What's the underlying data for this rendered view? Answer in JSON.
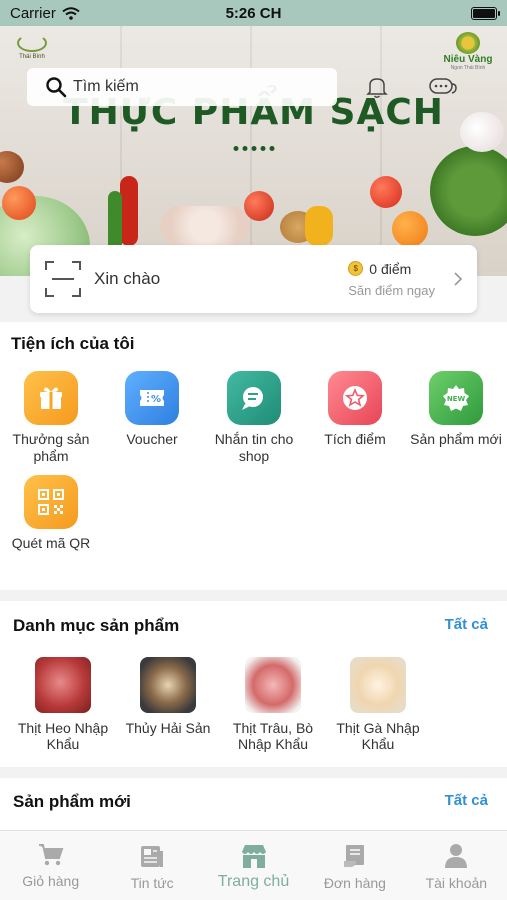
{
  "status_bar": {
    "carrier": "Carrier",
    "time": "5:26 CH"
  },
  "banner": {
    "title": "THỰC PHẨM SẠCH",
    "brand_left": "Thái Bình",
    "brand_right": "Niêu Vàng",
    "brand_right_sub": "Ngon Thái Bình"
  },
  "search": {
    "placeholder": "Tìm kiếm"
  },
  "greeting": {
    "text": "Xin chào",
    "points": "0 điểm",
    "points_action": "Săn điểm ngay"
  },
  "utilities": {
    "title": "Tiện ích của tôi",
    "items": [
      {
        "label": "Thưởng sản phẩm",
        "icon": "gift-icon",
        "color": "#f5a623"
      },
      {
        "label": "Voucher",
        "icon": "voucher-icon",
        "color": "#3a8ee6"
      },
      {
        "label": "Nhắn tin cho shop",
        "icon": "chat-icon",
        "color": "#2fa08a"
      },
      {
        "label": "Tích điểm",
        "icon": "star-icon",
        "color": "#ef5b6a"
      },
      {
        "label": "Sản phẩm mới",
        "icon": "new-badge-icon",
        "color": "#45b050"
      },
      {
        "label": "Quét mã QR",
        "icon": "qr-code-icon",
        "color": "#f5a623"
      }
    ]
  },
  "categories": {
    "title": "Danh mục sản phẩm",
    "see_all": "Tất cả",
    "items": [
      {
        "label": "Thịt Heo Nhập Khẩu"
      },
      {
        "label": "Thủy Hải Sản"
      },
      {
        "label": "Thịt Trâu, Bò Nhập Khẩu"
      },
      {
        "label": "Thịt Gà Nhập Khẩu"
      }
    ]
  },
  "new_products": {
    "title": "Sản phẩm mới",
    "see_all": "Tất cả"
  },
  "tabbar": {
    "items": [
      {
        "label": "Giỏ hàng",
        "icon": "cart-icon"
      },
      {
        "label": "Tin tức",
        "icon": "news-icon"
      },
      {
        "label": "Trang chủ",
        "icon": "store-icon",
        "active": true
      },
      {
        "label": "Đơn hàng",
        "icon": "orders-icon"
      },
      {
        "label": "Tài khoản",
        "icon": "account-icon"
      }
    ]
  },
  "colors": {
    "accent": "#2f8fd7",
    "active_tab": "#7fae9f",
    "banner_title": "#1f5a24"
  }
}
